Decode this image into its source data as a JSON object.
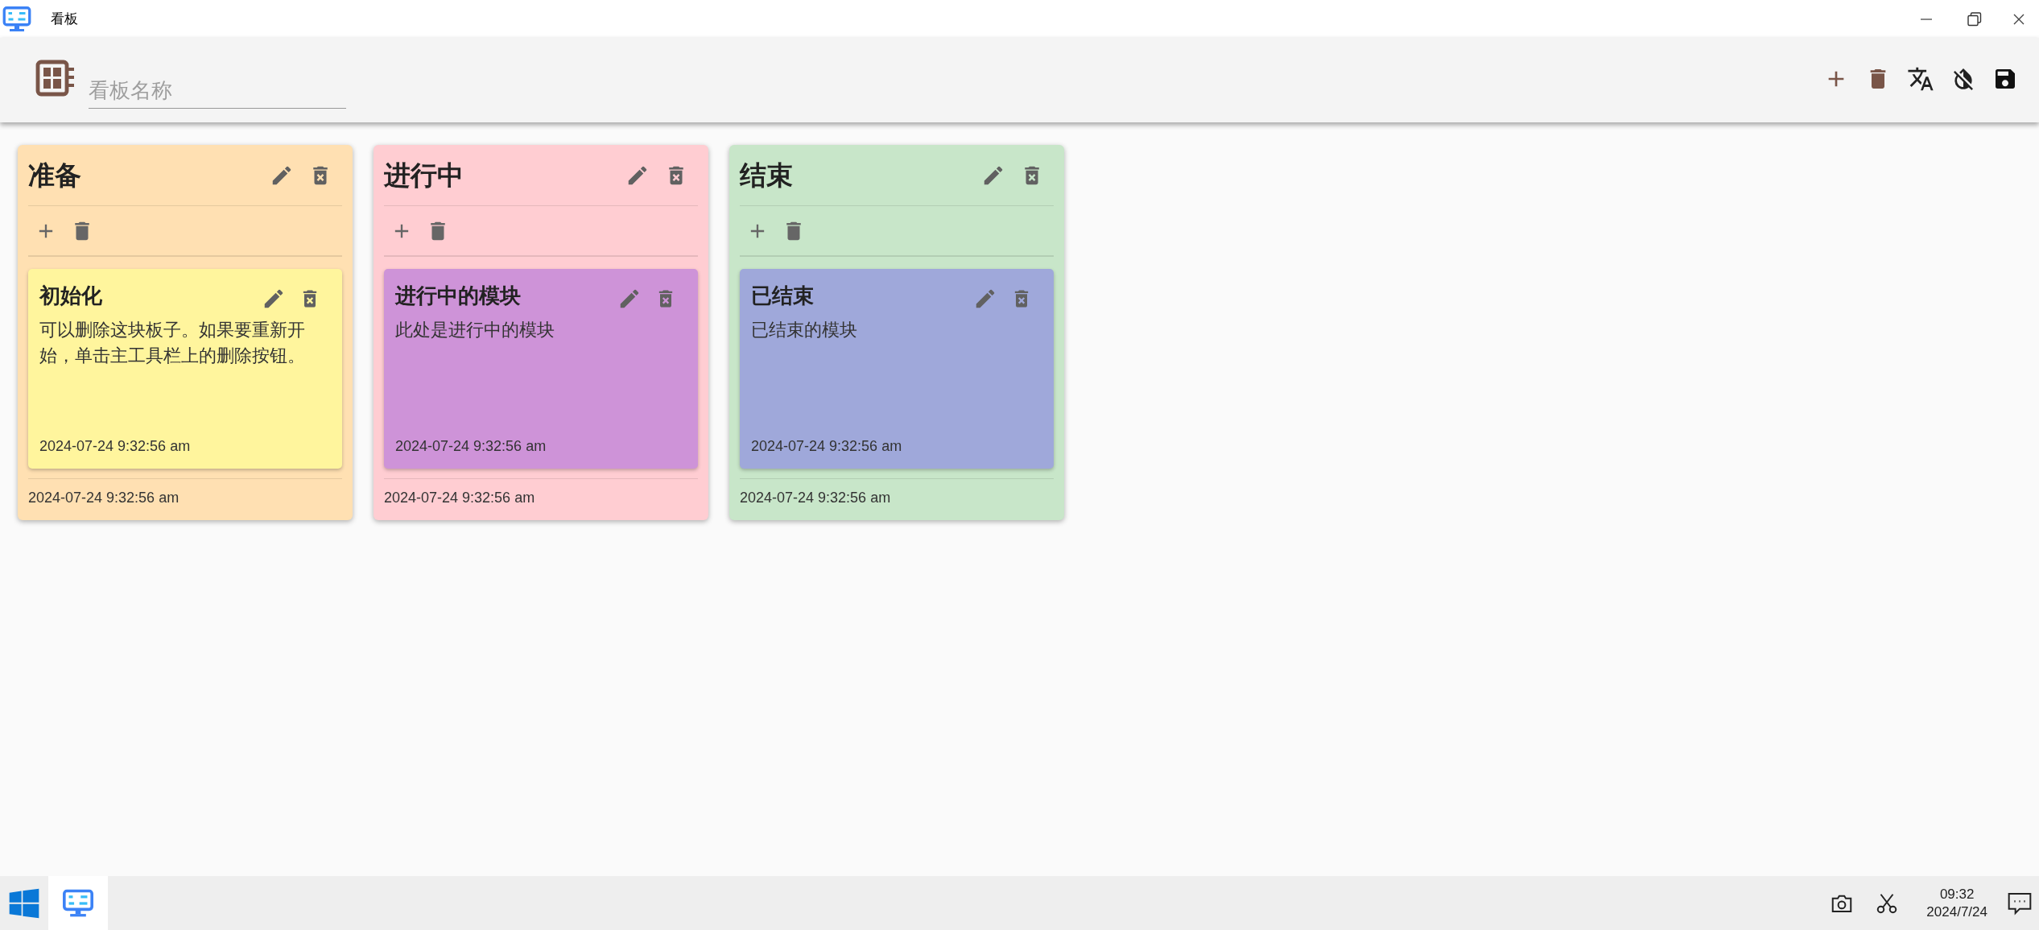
{
  "window": {
    "title": "看板"
  },
  "toolbar": {
    "placeholder": "看板名称"
  },
  "columns": [
    {
      "title": "准备",
      "color": "#ffe0b2",
      "cards": [
        {
          "title": "初始化",
          "body": "可以删除这块板子。如果要重新开始，单击主工具栏上的删除按钮。",
          "date": "2024-07-24 9:32:56 am",
          "color": "#fff59d"
        }
      ],
      "footer_date": "2024-07-24 9:32:56 am"
    },
    {
      "title": "进行中",
      "color": "#ffcdd2",
      "cards": [
        {
          "title": "进行中的模块",
          "body": "此处是进行中的模块",
          "date": "2024-07-24 9:32:56 am",
          "color": "#ce93d8"
        }
      ],
      "footer_date": "2024-07-24 9:32:56 am"
    },
    {
      "title": "结束",
      "color": "#c8e6c9",
      "cards": [
        {
          "title": "已结束",
          "body": "已结束的模块",
          "date": "2024-07-24 9:32:56 am",
          "color": "#9fa8da"
        }
      ],
      "footer_date": "2024-07-24 9:32:56 am"
    }
  ],
  "taskbar": {
    "time": "09:32",
    "date": "2024/7/24"
  }
}
